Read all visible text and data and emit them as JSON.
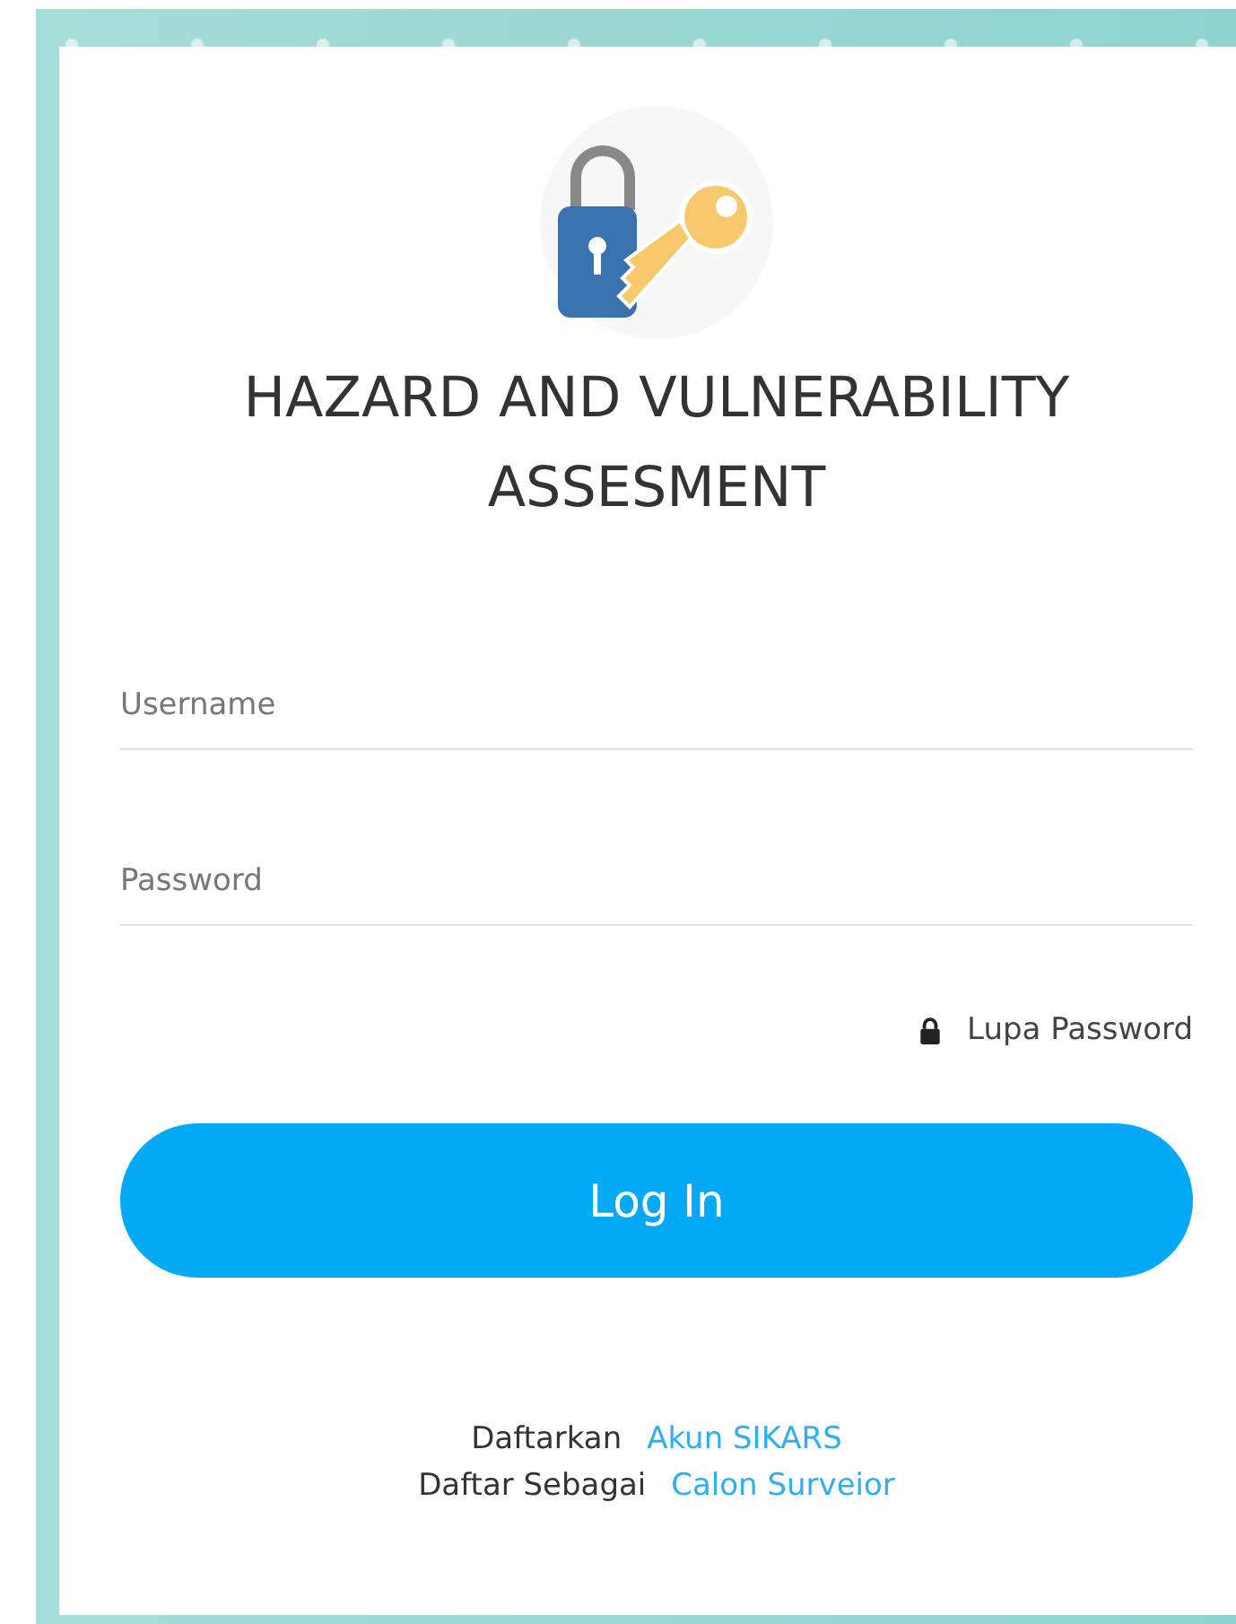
{
  "title": "HAZARD AND VULNERABILITY ASSESMENT",
  "fields": [
    {
      "placeholder": "Username"
    },
    {
      "placeholder": "Password"
    }
  ],
  "forgot_link": "Lupa Password",
  "login_button": "Log In",
  "register_lines": [
    {
      "text": "Daftarkan",
      "link": "Akun SIKARS"
    },
    {
      "text": "Daftar Sebagai",
      "link": "Calon Surveior"
    }
  ]
}
